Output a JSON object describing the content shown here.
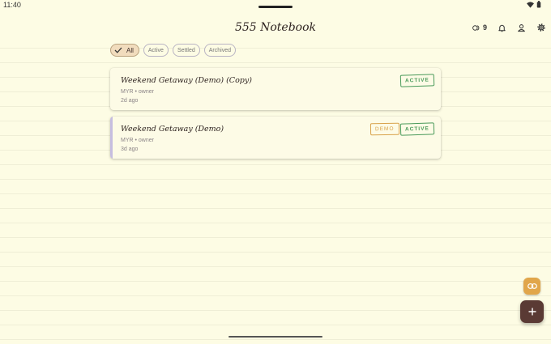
{
  "status": {
    "time": "11:40"
  },
  "app": {
    "title": "555 Notebook"
  },
  "header": {
    "coins": "9"
  },
  "filters": [
    {
      "label": "All",
      "selected": true
    },
    {
      "label": "Active",
      "selected": false
    },
    {
      "label": "Settled",
      "selected": false
    },
    {
      "label": "Archived",
      "selected": false
    }
  ],
  "notebooks": [
    {
      "title": "Weekend Getaway (Demo) (Copy)",
      "currency": "MYR",
      "role": "owner",
      "age": "2d ago",
      "badges": [
        "ACTIVE"
      ]
    },
    {
      "title": "Weekend Getaway (Demo)",
      "currency": "MYR",
      "role": "owner",
      "age": "3d ago",
      "badges": [
        "DEMO",
        "ACTIVE"
      ]
    }
  ],
  "colors": {
    "background": "#fdfce4",
    "active_badge": "#4a9a5a",
    "demo_badge": "#d8a24a",
    "demo_accent": "#c6bde0",
    "fab_primary": "#5a3a34",
    "fab_secondary": "#e1a64a"
  },
  "icons": {
    "coins": "coin-stack-icon",
    "notifications": "bell-icon",
    "account": "person-icon",
    "settings": "gear-icon",
    "link": "link-icon",
    "add": "plus-icon"
  }
}
